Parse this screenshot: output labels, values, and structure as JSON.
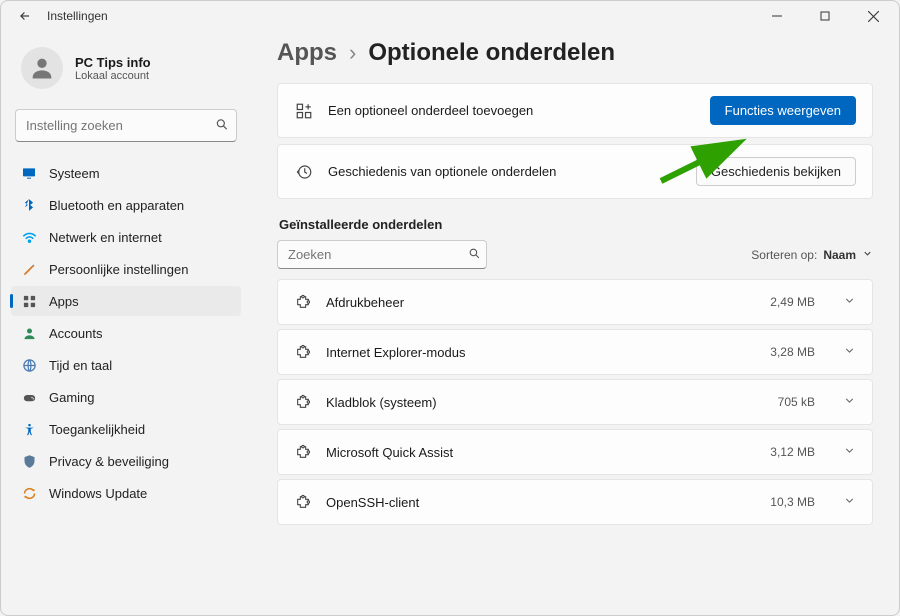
{
  "window": {
    "title": "Instellingen"
  },
  "profile": {
    "name": "PC Tips info",
    "subtitle": "Lokaal account"
  },
  "search": {
    "placeholder": "Instelling zoeken"
  },
  "sidebar": {
    "items": [
      {
        "id": "systeem",
        "label": "Systeem"
      },
      {
        "id": "bluetooth",
        "label": "Bluetooth en apparaten"
      },
      {
        "id": "netwerk",
        "label": "Netwerk en internet"
      },
      {
        "id": "persoonlijk",
        "label": "Persoonlijke instellingen"
      },
      {
        "id": "apps",
        "label": "Apps"
      },
      {
        "id": "accounts",
        "label": "Accounts"
      },
      {
        "id": "tijdentaal",
        "label": "Tijd en taal"
      },
      {
        "id": "gaming",
        "label": "Gaming"
      },
      {
        "id": "toegankelijkheid",
        "label": "Toegankelijkheid"
      },
      {
        "id": "privacy",
        "label": "Privacy & beveiliging"
      },
      {
        "id": "windowsupdate",
        "label": "Windows Update"
      }
    ]
  },
  "breadcrumb": {
    "parent": "Apps",
    "current": "Optionele onderdelen"
  },
  "cards": {
    "add": {
      "label": "Een optioneel onderdeel toevoegen",
      "button": "Functies weergeven"
    },
    "history": {
      "label": "Geschiedenis van optionele onderdelen",
      "button": "Geschiedenis bekijken"
    }
  },
  "installed": {
    "title": "Geïnstalleerde onderdelen",
    "search_placeholder": "Zoeken",
    "sort_label": "Sorteren op:",
    "sort_value": "Naam",
    "items": [
      {
        "name": "Afdrukbeheer",
        "size": "2,49 MB"
      },
      {
        "name": "Internet Explorer-modus",
        "size": "3,28 MB"
      },
      {
        "name": "Kladblok (systeem)",
        "size": "705 kB"
      },
      {
        "name": "Microsoft Quick Assist",
        "size": "3,12 MB"
      },
      {
        "name": "OpenSSH-client",
        "size": "10,3 MB"
      }
    ]
  }
}
